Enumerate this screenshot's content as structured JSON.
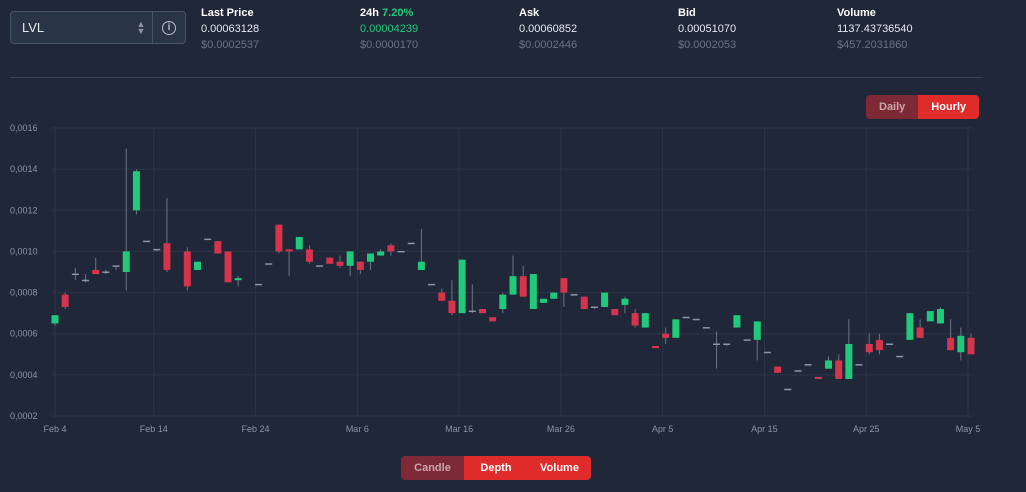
{
  "selector": {
    "value": "LVL",
    "chevron_icon": "chevron-updown-icon",
    "info_icon": "info-icon"
  },
  "stats": {
    "last_price": {
      "label": "Last Price",
      "value": "0.00063128",
      "usd": "$0.0002537"
    },
    "change_24h": {
      "label": "24h",
      "percent": "7.20%",
      "value": "0.00004239",
      "usd": "$0.0000170"
    },
    "ask": {
      "label": "Ask",
      "value": "0.00060852",
      "usd": "$0.0002446"
    },
    "bid": {
      "label": "Bid",
      "value": "0.00051070",
      "usd": "$0.0002053"
    },
    "volume": {
      "label": "Volume",
      "value": "1137.43736540",
      "usd": "$457.2031860"
    }
  },
  "interval_toggle": {
    "daily": "Daily",
    "hourly": "Hourly",
    "selected": "Hourly"
  },
  "view_toggle": {
    "candle": "Candle",
    "depth": "Depth",
    "volume": "Volume"
  },
  "colors": {
    "up": "#21c97a",
    "down": "#d6344d",
    "background": "#1f2738",
    "accent": "#e02b2b"
  },
  "chart_data": {
    "type": "candlestick",
    "y_ticks": [
      "0,0016",
      "0,0014",
      "0,0012",
      "0,0010",
      "0,0008",
      "0,0006",
      "0,0004",
      "0,0002"
    ],
    "ylim": [
      0.0002,
      0.0016
    ],
    "x_ticks": [
      "Feb 4",
      "Feb 14",
      "Feb 24",
      "Mar 6",
      "Mar 16",
      "Mar 26",
      "Apr 5",
      "Apr 15",
      "Apr 25",
      "May 5"
    ],
    "xlim": [
      0,
      90
    ],
    "grid": true,
    "candles": [
      {
        "d": 0,
        "o": 0.00065,
        "h": 0.00069,
        "l": 0.00064,
        "c": 0.00069
      },
      {
        "d": 1,
        "o": 0.00079,
        "h": 0.0008,
        "l": 0.00072,
        "c": 0.00073
      },
      {
        "d": 2,
        "o": 0.00089,
        "h": 0.00092,
        "l": 0.00086,
        "c": 0.00089
      },
      {
        "d": 3,
        "o": 0.00086,
        "h": 0.00089,
        "l": 0.00085,
        "c": 0.00086
      },
      {
        "d": 4,
        "o": 0.00091,
        "h": 0.00097,
        "l": 0.00089,
        "c": 0.00089
      },
      {
        "d": 5,
        "o": 0.0009,
        "h": 0.00091,
        "l": 0.00089,
        "c": 0.0009
      },
      {
        "d": 6,
        "o": 0.00093,
        "h": 0.00093,
        "l": 0.00091,
        "c": 0.00093
      },
      {
        "d": 7,
        "o": 0.0009,
        "h": 0.0015,
        "l": 0.00081,
        "c": 0.001
      },
      {
        "d": 8,
        "o": 0.0012,
        "h": 0.0014,
        "l": 0.00118,
        "c": 0.00139
      },
      {
        "d": 9,
        "o": 0.00105,
        "h": 0.00105,
        "l": 0.00105,
        "c": 0.00105
      },
      {
        "d": 10,
        "o": 0.00101,
        "h": 0.00101,
        "l": 0.001,
        "c": 0.00101
      },
      {
        "d": 11,
        "o": 0.00104,
        "h": 0.00126,
        "l": 0.0009,
        "c": 0.00091
      },
      {
        "d": 13,
        "o": 0.001,
        "h": 0.00102,
        "l": 0.00081,
        "c": 0.00083
      },
      {
        "d": 14,
        "o": 0.00091,
        "h": 0.00095,
        "l": 0.00091,
        "c": 0.00095
      },
      {
        "d": 15,
        "o": 0.00106,
        "h": 0.00106,
        "l": 0.00106,
        "c": 0.00106
      },
      {
        "d": 16,
        "o": 0.00105,
        "h": 0.00105,
        "l": 0.00099,
        "c": 0.00099
      },
      {
        "d": 17,
        "o": 0.001,
        "h": 0.001,
        "l": 0.00085,
        "c": 0.00085
      },
      {
        "d": 18,
        "o": 0.00086,
        "h": 0.00088,
        "l": 0.00083,
        "c": 0.00087
      },
      {
        "d": 20,
        "o": 0.00084,
        "h": 0.00084,
        "l": 0.00084,
        "c": 0.00084
      },
      {
        "d": 21,
        "o": 0.00094,
        "h": 0.00094,
        "l": 0.00094,
        "c": 0.00094
      },
      {
        "d": 22,
        "o": 0.00113,
        "h": 0.00113,
        "l": 0.00099,
        "c": 0.001
      },
      {
        "d": 23,
        "o": 0.00101,
        "h": 0.00101,
        "l": 0.00088,
        "c": 0.001
      },
      {
        "d": 24,
        "o": 0.00101,
        "h": 0.00107,
        "l": 0.00101,
        "c": 0.00107
      },
      {
        "d": 25,
        "o": 0.00101,
        "h": 0.00103,
        "l": 0.00094,
        "c": 0.00095
      },
      {
        "d": 26,
        "o": 0.00093,
        "h": 0.00093,
        "l": 0.00093,
        "c": 0.00093
      },
      {
        "d": 27,
        "o": 0.00097,
        "h": 0.00097,
        "l": 0.00094,
        "c": 0.00094
      },
      {
        "d": 28,
        "o": 0.00095,
        "h": 0.00098,
        "l": 0.00092,
        "c": 0.00093
      },
      {
        "d": 29,
        "o": 0.00093,
        "h": 0.001,
        "l": 0.00088,
        "c": 0.001
      },
      {
        "d": 30,
        "o": 0.00095,
        "h": 0.00095,
        "l": 0.00089,
        "c": 0.00091
      },
      {
        "d": 31,
        "o": 0.00095,
        "h": 0.00099,
        "l": 0.00091,
        "c": 0.00099
      },
      {
        "d": 32,
        "o": 0.00098,
        "h": 0.00101,
        "l": 0.00098,
        "c": 0.001
      },
      {
        "d": 33,
        "o": 0.00103,
        "h": 0.00104,
        "l": 0.00098,
        "c": 0.001
      },
      {
        "d": 34,
        "o": 0.001,
        "h": 0.001,
        "l": 0.001,
        "c": 0.001
      },
      {
        "d": 35,
        "o": 0.00104,
        "h": 0.00104,
        "l": 0.00104,
        "c": 0.00104
      },
      {
        "d": 36,
        "o": 0.00091,
        "h": 0.00111,
        "l": 0.00091,
        "c": 0.00095
      },
      {
        "d": 37,
        "o": 0.00084,
        "h": 0.00084,
        "l": 0.00084,
        "c": 0.00084
      },
      {
        "d": 38,
        "o": 0.0008,
        "h": 0.00082,
        "l": 0.00076,
        "c": 0.00076
      },
      {
        "d": 39,
        "o": 0.00076,
        "h": 0.00086,
        "l": 0.00069,
        "c": 0.0007
      },
      {
        "d": 40,
        "o": 0.0007,
        "h": 0.00096,
        "l": 0.0007,
        "c": 0.00096
      },
      {
        "d": 41,
        "o": 0.00071,
        "h": 0.00084,
        "l": 0.0007,
        "c": 0.00071
      },
      {
        "d": 42,
        "o": 0.00072,
        "h": 0.00072,
        "l": 0.0007,
        "c": 0.0007
      },
      {
        "d": 43,
        "o": 0.00068,
        "h": 0.00068,
        "l": 0.00066,
        "c": 0.00066
      },
      {
        "d": 44,
        "o": 0.00072,
        "h": 0.0008,
        "l": 0.0007,
        "c": 0.00079
      },
      {
        "d": 45,
        "o": 0.00079,
        "h": 0.00098,
        "l": 0.00079,
        "c": 0.00088
      },
      {
        "d": 46,
        "o": 0.00088,
        "h": 0.00093,
        "l": 0.00078,
        "c": 0.00078
      },
      {
        "d": 47,
        "o": 0.00072,
        "h": 0.00089,
        "l": 0.00072,
        "c": 0.00089
      },
      {
        "d": 48,
        "o": 0.00075,
        "h": 0.00077,
        "l": 0.00075,
        "c": 0.00077
      },
      {
        "d": 49,
        "o": 0.00077,
        "h": 0.0008,
        "l": 0.00077,
        "c": 0.0008
      },
      {
        "d": 50,
        "o": 0.00087,
        "h": 0.00087,
        "l": 0.00073,
        "c": 0.0008
      },
      {
        "d": 51,
        "o": 0.00079,
        "h": 0.00079,
        "l": 0.00079,
        "c": 0.00079
      },
      {
        "d": 52,
        "o": 0.00078,
        "h": 0.00078,
        "l": 0.00072,
        "c": 0.00072
      },
      {
        "d": 53,
        "o": 0.00073,
        "h": 0.00073,
        "l": 0.00072,
        "c": 0.00073
      },
      {
        "d": 54,
        "o": 0.00073,
        "h": 0.0008,
        "l": 0.00073,
        "c": 0.0008
      },
      {
        "d": 55,
        "o": 0.00072,
        "h": 0.00072,
        "l": 0.00069,
        "c": 0.00069
      },
      {
        "d": 56,
        "o": 0.00074,
        "h": 0.00078,
        "l": 0.0007,
        "c": 0.00077
      },
      {
        "d": 57,
        "o": 0.0007,
        "h": 0.00072,
        "l": 0.00063,
        "c": 0.00064
      },
      {
        "d": 58,
        "o": 0.00063,
        "h": 0.0007,
        "l": 0.00063,
        "c": 0.0007
      },
      {
        "d": 59,
        "o": 0.00054,
        "h": 0.00054,
        "l": 0.00053,
        "c": 0.00053
      },
      {
        "d": 60,
        "o": 0.0006,
        "h": 0.00063,
        "l": 0.00055,
        "c": 0.00058
      },
      {
        "d": 61,
        "o": 0.00058,
        "h": 0.00067,
        "l": 0.00058,
        "c": 0.00067
      },
      {
        "d": 62,
        "o": 0.00068,
        "h": 0.00068,
        "l": 0.00068,
        "c": 0.00068
      },
      {
        "d": 63,
        "o": 0.00067,
        "h": 0.00067,
        "l": 0.00067,
        "c": 0.00067
      },
      {
        "d": 64,
        "o": 0.00063,
        "h": 0.00063,
        "l": 0.00063,
        "c": 0.00063
      },
      {
        "d": 65,
        "o": 0.00055,
        "h": 0.00061,
        "l": 0.00043,
        "c": 0.00055
      },
      {
        "d": 66,
        "o": 0.00055,
        "h": 0.00055,
        "l": 0.00054,
        "c": 0.00055
      },
      {
        "d": 67,
        "o": 0.00063,
        "h": 0.00069,
        "l": 0.00063,
        "c": 0.00069
      },
      {
        "d": 68,
        "o": 0.00057,
        "h": 0.00057,
        "l": 0.00057,
        "c": 0.00057
      },
      {
        "d": 69,
        "o": 0.00057,
        "h": 0.00066,
        "l": 0.00047,
        "c": 0.00066
      },
      {
        "d": 70,
        "o": 0.00051,
        "h": 0.00051,
        "l": 0.00051,
        "c": 0.00051
      },
      {
        "d": 71,
        "o": 0.00044,
        "h": 0.00044,
        "l": 0.00041,
        "c": 0.00041
      },
      {
        "d": 72,
        "o": 0.00033,
        "h": 0.00033,
        "l": 0.00033,
        "c": 0.00033
      },
      {
        "d": 73,
        "o": 0.00042,
        "h": 0.00042,
        "l": 0.00042,
        "c": 0.00042
      },
      {
        "d": 74,
        "o": 0.00045,
        "h": 0.00045,
        "l": 0.00045,
        "c": 0.00045
      },
      {
        "d": 75,
        "o": 0.00039,
        "h": 0.00039,
        "l": 0.00038,
        "c": 0.00038
      },
      {
        "d": 76,
        "o": 0.00043,
        "h": 0.00049,
        "l": 0.00043,
        "c": 0.00047
      },
      {
        "d": 77,
        "o": 0.00047,
        "h": 0.0005,
        "l": 0.00038,
        "c": 0.00038
      },
      {
        "d": 78,
        "o": 0.00038,
        "h": 0.00067,
        "l": 0.00038,
        "c": 0.00055
      },
      {
        "d": 79,
        "o": 0.00045,
        "h": 0.00045,
        "l": 0.00045,
        "c": 0.00045
      },
      {
        "d": 80,
        "o": 0.00055,
        "h": 0.0006,
        "l": 0.0005,
        "c": 0.00051
      },
      {
        "d": 81,
        "o": 0.00057,
        "h": 0.0006,
        "l": 0.0005,
        "c": 0.00052
      },
      {
        "d": 82,
        "o": 0.00055,
        "h": 0.00055,
        "l": 0.00055,
        "c": 0.00055
      },
      {
        "d": 83,
        "o": 0.00049,
        "h": 0.00049,
        "l": 0.00049,
        "c": 0.00049
      },
      {
        "d": 84,
        "o": 0.00057,
        "h": 0.0007,
        "l": 0.00057,
        "c": 0.0007
      },
      {
        "d": 85,
        "o": 0.00063,
        "h": 0.00067,
        "l": 0.00058,
        "c": 0.00058
      },
      {
        "d": 86,
        "o": 0.00066,
        "h": 0.00071,
        "l": 0.00066,
        "c": 0.00071
      },
      {
        "d": 87,
        "o": 0.00065,
        "h": 0.00073,
        "l": 0.00065,
        "c": 0.00072
      },
      {
        "d": 88,
        "o": 0.00058,
        "h": 0.00067,
        "l": 0.00052,
        "c": 0.00052
      },
      {
        "d": 89,
        "o": 0.00051,
        "h": 0.00063,
        "l": 0.00047,
        "c": 0.00059
      },
      {
        "d": 90,
        "o": 0.00058,
        "h": 0.0006,
        "l": 0.0005,
        "c": 0.0005
      }
    ]
  }
}
